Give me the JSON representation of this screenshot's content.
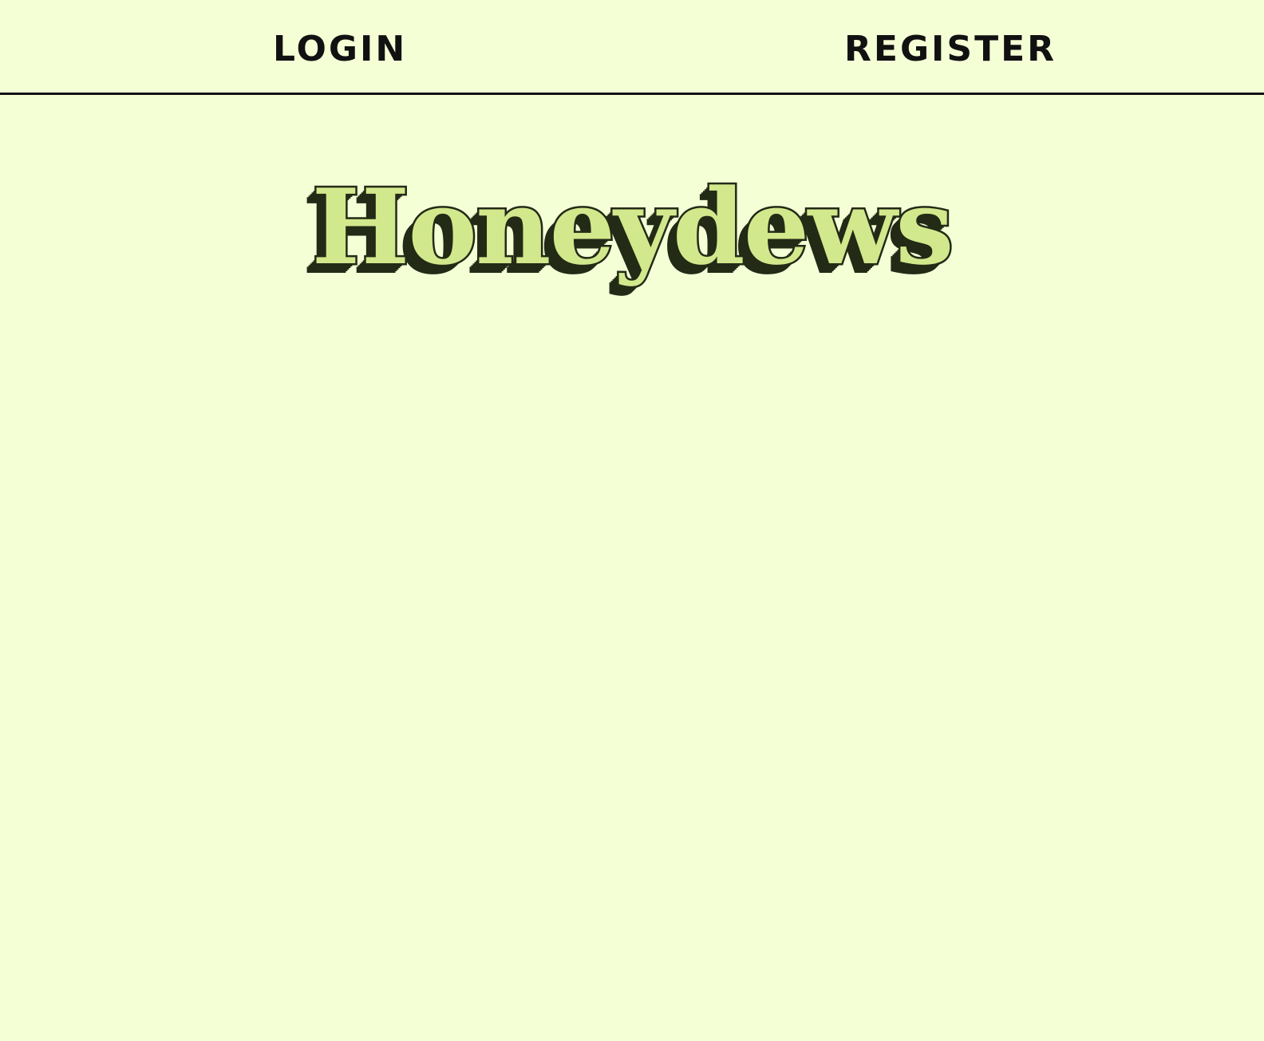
{
  "nav": {
    "login_label": "LOGIN",
    "register_label": "REGISTER"
  },
  "hero": {
    "title": "Honeydews"
  },
  "colors": {
    "background": "#f5ffd6",
    "title_fill": "#d2e88c",
    "title_outline": "#232a16",
    "text": "#111111"
  }
}
